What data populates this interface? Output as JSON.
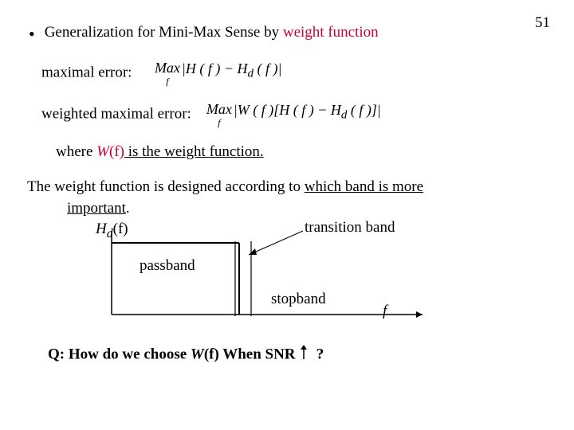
{
  "page_number": "51",
  "bullet": {
    "prefix": "Generalization for Mini-Max Sense by ",
    "highlighted": "weight function"
  },
  "lines": {
    "maximal_error_label": "maximal error:",
    "weighted_maximal_error_label": "weighted maximal error:",
    "where_prefix": "where ",
    "where_wf": "W",
    "where_f": "(f)",
    "where_suffix": " is the weight function.",
    "design_prefix": "The weight function is designed according to ",
    "design_under1": "which band is more",
    "design_under2": "important",
    "design_dot": "."
  },
  "diagram": {
    "hd_label_H": "H",
    "hd_label_d": "d",
    "hd_label_f": "(f)",
    "transition": "transition band",
    "passband": "passband",
    "stopband": "stopband",
    "axis": "f"
  },
  "formula1": {
    "max": "Max",
    "sub": "f",
    "body": "|H ( f ) − H",
    "sub_d": "d",
    "body2": " ( f )|"
  },
  "formula2": {
    "max": "Max",
    "sub": "f",
    "body": "|W ( f )[H ( f ) − H",
    "sub_d": "d",
    "body2": " ( f )]|"
  },
  "question": {
    "prefix": "Q: How do we choose ",
    "wf": "W",
    "f": "(f)",
    "mid": " When SNR ",
    "mark": "?"
  }
}
